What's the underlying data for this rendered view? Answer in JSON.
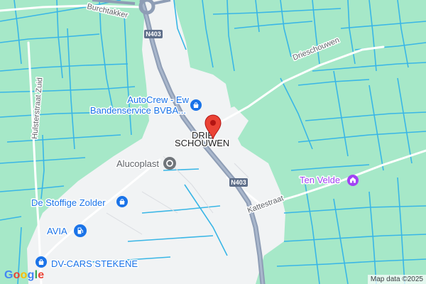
{
  "map": {
    "roads": {
      "burchtakker": "Burchtakker",
      "n403_top": "N403",
      "n403_mid": "N403",
      "drieschouwen": "Drieschouwen",
      "hulsterstraat": "Hulsterstraat Zuid",
      "kattestraat": "Kattestraat"
    },
    "places": {
      "village_line1": "DRIE",
      "village_line2": "SCHOUWEN"
    },
    "pois": {
      "autocrew_line1": "AutoCrew - Ew",
      "autocrew_line2": "Bandenservice BVBA...",
      "alucoplast": "Alucoplast",
      "stoffige": "De Stoffige Zolder",
      "avia": "AVIA",
      "dvcars": "DV-CARS STEKENE",
      "tenvelde": "Ten Velde"
    },
    "attribution": "Map data ©2025",
    "logo": "Google"
  },
  "colors": {
    "background": "#a6e8c8",
    "waterways": "#39b6e6",
    "main_road": "#8e9db5",
    "built_area": "#f1f3f4",
    "marker": "#ea4335",
    "poi_blue": "#1a73e8",
    "poi_purple": "#a142f4"
  },
  "icons": [
    "map-pin-icon",
    "shopping-bag-icon",
    "fuel-pump-icon",
    "place-icon",
    "monument-icon"
  ]
}
